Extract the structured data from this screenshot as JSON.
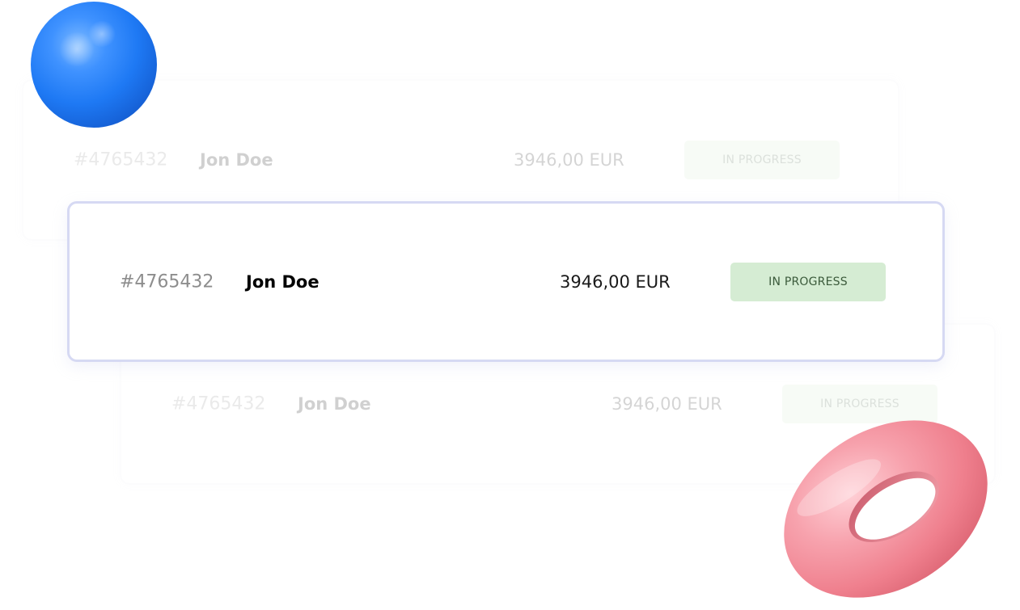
{
  "rows": [
    {
      "id": "#4765432",
      "name": "Jon Doe",
      "amount": "3946,00 EUR",
      "status": "IN PROGRESS"
    },
    {
      "id": "#4765432",
      "name": "Jon Doe",
      "amount": "3946,00 EUR",
      "status": "IN PROGRESS"
    },
    {
      "id": "#4765432",
      "name": "Jon Doe",
      "amount": "3946,00 EUR",
      "status": "IN PROGRESS"
    }
  ],
  "colors": {
    "status_badge_bg": "#d5ecd3",
    "status_badge_text": "#3b5a3b",
    "selected_card_border": "#d6d9f3",
    "sphere": "#1e79f4",
    "torus": "#f08a96"
  },
  "decorations": [
    "blue-sphere",
    "pink-torus"
  ]
}
